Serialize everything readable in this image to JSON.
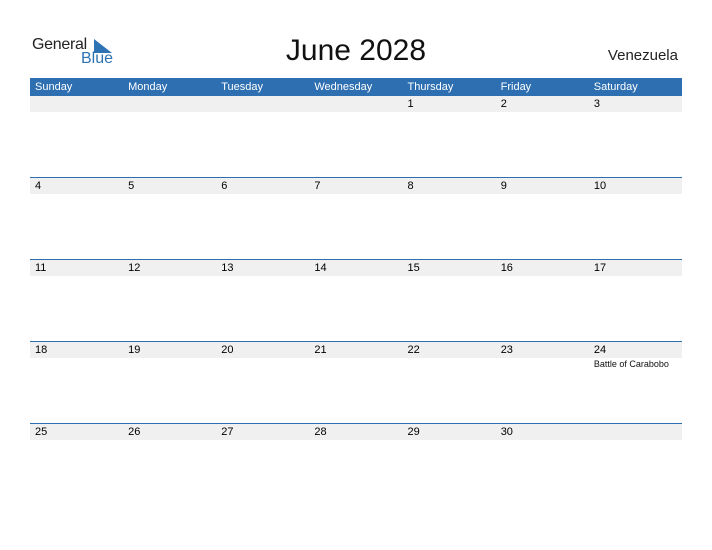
{
  "logo": {
    "general": "General",
    "blue": "Blue"
  },
  "title": "June 2028",
  "country": "Venezuela",
  "accent": "#2e6fb2",
  "weekdays": [
    "Sunday",
    "Monday",
    "Tuesday",
    "Wednesday",
    "Thursday",
    "Friday",
    "Saturday"
  ],
  "weeks": [
    [
      {
        "d": ""
      },
      {
        "d": ""
      },
      {
        "d": ""
      },
      {
        "d": ""
      },
      {
        "d": "1"
      },
      {
        "d": "2"
      },
      {
        "d": "3"
      }
    ],
    [
      {
        "d": "4"
      },
      {
        "d": "5"
      },
      {
        "d": "6"
      },
      {
        "d": "7"
      },
      {
        "d": "8"
      },
      {
        "d": "9"
      },
      {
        "d": "10"
      }
    ],
    [
      {
        "d": "11"
      },
      {
        "d": "12"
      },
      {
        "d": "13"
      },
      {
        "d": "14"
      },
      {
        "d": "15"
      },
      {
        "d": "16"
      },
      {
        "d": "17"
      }
    ],
    [
      {
        "d": "18"
      },
      {
        "d": "19"
      },
      {
        "d": "20"
      },
      {
        "d": "21"
      },
      {
        "d": "22"
      },
      {
        "d": "23"
      },
      {
        "d": "24",
        "event": "Battle of Carabobo"
      }
    ],
    [
      {
        "d": "25"
      },
      {
        "d": "26"
      },
      {
        "d": "27"
      },
      {
        "d": "28"
      },
      {
        "d": "29"
      },
      {
        "d": "30"
      },
      {
        "d": ""
      }
    ]
  ]
}
